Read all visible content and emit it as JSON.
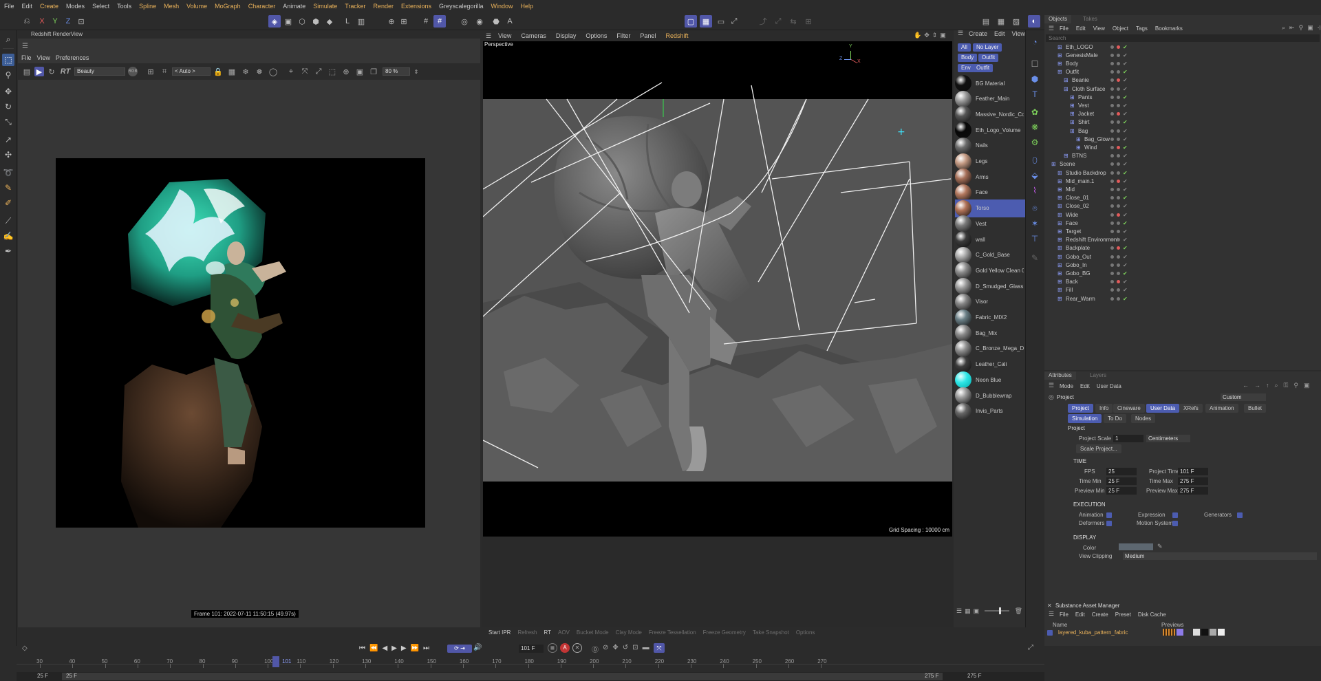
{
  "menubar": [
    "File",
    "Edit",
    "Create",
    "Modes",
    "Select",
    "Tools",
    "Spline",
    "Mesh",
    "Volume",
    "MoGraph",
    "Character",
    "Animate",
    "Simulate",
    "Tracker",
    "Render",
    "Extensions",
    "Greyscalegorilla",
    "Window",
    "Help"
  ],
  "menubar_highlight": [
    "Create",
    "Spline",
    "Mesh",
    "Volume",
    "MoGraph",
    "Character",
    "Simulate",
    "Tracker",
    "Render",
    "Extensions",
    "Window",
    "Help"
  ],
  "toolbar": {
    "x": "X",
    "y": "Y",
    "z": "Z"
  },
  "renderview": {
    "title": "Redshift RenderView",
    "menu": [
      "File",
      "View",
      "Preferences"
    ],
    "aov": "Beauty",
    "auto": "< Auto >",
    "zoom": "80 %",
    "rt": "RT",
    "frame_label": "Frame 101:  2022-07-11  11:50:15  (49.97s)"
  },
  "viewport": {
    "menu": [
      "View",
      "Cameras",
      "Display",
      "Options",
      "Filter",
      "Panel",
      "Redshift"
    ],
    "camera": "Perspective",
    "grid_spacing": "Grid Spacing : 10000 cm",
    "axis": {
      "x": "X",
      "y": "Y",
      "z": "Z"
    },
    "status": [
      "Start IPR",
      "Refresh",
      "RT",
      "AOV",
      "Bucket Mode",
      "Clay Mode",
      "Freeze Tessellation",
      "Freeze Geometry",
      "Take Snapshot",
      "Options"
    ]
  },
  "materials": {
    "menu": [
      "Create",
      "Edit",
      "View"
    ],
    "filters": [
      "All",
      "No Layer",
      "Body",
      "Outfit",
      "Env",
      "Outfit"
    ],
    "items": [
      {
        "name": "BG Material",
        "color": "#111111"
      },
      {
        "name": "Feather_Main",
        "color": "#9a9a9a"
      },
      {
        "name": "Massive_Nordic_Co",
        "color": "#555555"
      },
      {
        "name": "Eth_Logo_Volume",
        "color": "#080808"
      },
      {
        "name": "Nails",
        "color": "#6c6c6c"
      },
      {
        "name": "Legs",
        "color": "#c49a83"
      },
      {
        "name": "Arms",
        "color": "#a66f58"
      },
      {
        "name": "Face",
        "color": "#b3785e"
      },
      {
        "name": "Torso",
        "color": "#b07257",
        "selected": true
      },
      {
        "name": "Vest",
        "color": "#7b7b7b"
      },
      {
        "name": "wall",
        "color": "#3a3a3a"
      },
      {
        "name": "C_Gold_Base",
        "color": "#aaaaaa"
      },
      {
        "name": "Gold Yellow Clean 0",
        "color": "#8d8d8d"
      },
      {
        "name": "D_Smudged_Glass",
        "color": "#9a9a9a"
      },
      {
        "name": "Visor",
        "color": "#868686"
      },
      {
        "name": "Fabric_MIX2",
        "color": "#6a7f86"
      },
      {
        "name": "Bag_Mix",
        "color": "#8a8a8a"
      },
      {
        "name": "C_Bronze_Mega_Da",
        "color": "#8f8f8f"
      },
      {
        "name": "Leather_Cali",
        "color": "#3d3d3d"
      },
      {
        "name": "Neon Blue",
        "color": "#2ee6e6"
      },
      {
        "name": "D_Bubblewrap",
        "color": "#9a9a9a"
      },
      {
        "name": "Invis_Parts",
        "color": "#666666"
      }
    ]
  },
  "objects": {
    "tabs": [
      "Objects",
      "Takes"
    ],
    "menu": [
      "File",
      "Edit",
      "View",
      "Object",
      "Tags",
      "Bookmarks"
    ],
    "search_placeholder": "Search",
    "rows": [
      {
        "name": "Eth_LOGO",
        "indent": 1
      },
      {
        "name": "GenesisMale",
        "indent": 1
      },
      {
        "name": "Body",
        "indent": 1
      },
      {
        "name": "Outfit",
        "indent": 1
      },
      {
        "name": "Beanie",
        "indent": 2
      },
      {
        "name": "Cloth Surface",
        "indent": 2
      },
      {
        "name": "Pants",
        "indent": 3
      },
      {
        "name": "Vest",
        "indent": 3
      },
      {
        "name": "Jacket",
        "indent": 3
      },
      {
        "name": "Shirt",
        "indent": 3
      },
      {
        "name": "Bag",
        "indent": 3
      },
      {
        "name": "Bag_Glow",
        "indent": 4
      },
      {
        "name": "Wind",
        "indent": 4
      },
      {
        "name": "BTNS",
        "indent": 2
      },
      {
        "name": "Scene",
        "indent": 0
      },
      {
        "name": "Studio Backdrop",
        "indent": 1
      },
      {
        "name": "Mid_main.1",
        "indent": 1
      },
      {
        "name": "Mid",
        "indent": 1
      },
      {
        "name": "Close_01",
        "indent": 1
      },
      {
        "name": "Close_02",
        "indent": 1
      },
      {
        "name": "Wide",
        "indent": 1
      },
      {
        "name": "Face",
        "indent": 1
      },
      {
        "name": "Target",
        "indent": 1
      },
      {
        "name": "Redshift Environment",
        "indent": 1
      },
      {
        "name": "Backplate",
        "indent": 1
      },
      {
        "name": "Gobo_Out",
        "indent": 1
      },
      {
        "name": "Gobo_In",
        "indent": 1
      },
      {
        "name": "Gobo_BG",
        "indent": 1
      },
      {
        "name": "Back",
        "indent": 1
      },
      {
        "name": "Fill",
        "indent": 1
      },
      {
        "name": "Rear_Warm",
        "indent": 1
      }
    ]
  },
  "attributes": {
    "tabs": [
      "Attributes",
      "Layers"
    ],
    "menu": [
      "Mode",
      "Edit",
      "User Data"
    ],
    "object": "Project",
    "preset": "Custom",
    "buttons_row1": [
      "Project",
      "Info",
      "Cineware",
      "User Data",
      "XRefs",
      "Animation",
      "Bullet"
    ],
    "buttons_row2": [
      "Simulation",
      "To Do",
      "Nodes"
    ],
    "section_project": "Project",
    "project_scale_label": "Project Scale",
    "project_scale_value": "1",
    "project_scale_unit": "Centimeters",
    "scale_project_btn": "Scale Project...",
    "time_header": "TIME",
    "fps_label": "FPS",
    "fps": "25",
    "project_time_label": "Project Time",
    "project_time": "101 F",
    "time_min_label": "Time Min",
    "time_min": "25 F",
    "time_max_label": "Time Max",
    "time_max": "275 F",
    "preview_min_label": "Preview Min",
    "preview_min": "25 F",
    "preview_max_label": "Preview Max",
    "preview_max": "275 F",
    "execution_header": "EXECUTION",
    "animation_label": "Animation",
    "expression_label": "Expression",
    "generators_label": "Generators",
    "deformers_label": "Deformers",
    "motion_system_label": "Motion System",
    "display_header": "DISPLAY",
    "color_label": "Color",
    "view_clipping_label": "View Clipping",
    "view_clipping": "Medium"
  },
  "substance": {
    "title": "Substance Asset Manager",
    "menu": [
      "File",
      "Edit",
      "Create",
      "Preset",
      "Disk Cache"
    ],
    "col_name": "Name",
    "col_previews": "Previews",
    "item": "layered_kuba_pattern_fabric"
  },
  "timeline": {
    "current_frame": "101 F",
    "current_marker": "101",
    "start_left": "25 F",
    "start_left2": "25 F",
    "end_right": "275 F",
    "end_right2": "275 F",
    "ticks": [
      "30",
      "40",
      "50",
      "60",
      "70",
      "80",
      "90",
      "100",
      "110",
      "120",
      "130",
      "140",
      "150",
      "160",
      "170",
      "180",
      "190",
      "200",
      "210",
      "220",
      "230",
      "240",
      "250",
      "260",
      "270"
    ]
  }
}
